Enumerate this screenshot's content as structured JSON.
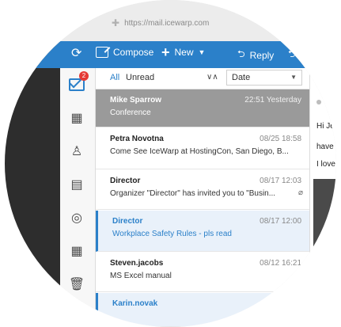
{
  "browser": {
    "url": "https://mail.icewarp.com"
  },
  "toolbar": {
    "compose_label": "Compose",
    "new_label": "New",
    "reply_label": "Reply",
    "accent_color": "#2b80c9"
  },
  "sidebar": {
    "mail_badge": "2",
    "icons": [
      "mail-icon",
      "calendar-icon",
      "contacts-icon",
      "notes-icon",
      "tasks-icon",
      "events-icon",
      "trash-icon"
    ]
  },
  "filters": {
    "all": "All",
    "unread": "Unread",
    "sort_toggle": "∨∧",
    "sort_by": "Date"
  },
  "messages": [
    {
      "sender": "Mike Sparrow",
      "time": "22:51 Yesterday",
      "subject": "Conference"
    },
    {
      "sender": "Petra Novotna",
      "time": "08/25 18:58",
      "subject": "Come See IceWarp at HostingCon, San Diego, B..."
    },
    {
      "sender": "Director",
      "time": "08/17 12:03",
      "subject": "Organizer \"Director\" has invited you to \"Busin..."
    },
    {
      "sender": "Director",
      "time": "08/17 12:00",
      "subject": "Workplace Safety Rules - pls read"
    },
    {
      "sender": "Steven.jacobs",
      "time": "08/12 16:21",
      "subject": "MS Excel manual"
    },
    {
      "sender": "Karin.novak",
      "time": "",
      "subject": ""
    }
  ],
  "preview": {
    "line1": "Hi Je",
    "line2": "have y",
    "line3": "I love c"
  }
}
